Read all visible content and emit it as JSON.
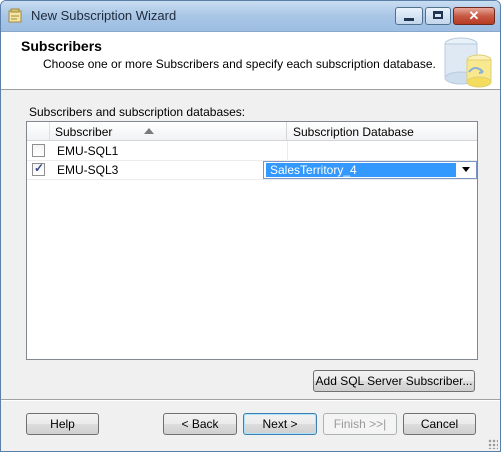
{
  "window": {
    "title": "New Subscription Wizard",
    "close_glyph": "✕"
  },
  "header": {
    "title": "Subscribers",
    "description": "Choose one or more Subscribers and specify each subscription database."
  },
  "section_label": "Subscribers and subscription databases:",
  "grid": {
    "columns": [
      "Subscriber",
      "Subscription Database"
    ],
    "sort_icon": "sort-ascending-icon",
    "rows": [
      {
        "subscriber": "EMU-SQL1",
        "checked": false,
        "database": ""
      },
      {
        "subscriber": "EMU-SQL3",
        "checked": true,
        "database": "SalesTerritory_4"
      }
    ]
  },
  "buttons": {
    "add_subscriber": "Add SQL Server Subscriber...",
    "help": "Help",
    "back": "< Back",
    "next": "Next >",
    "finish": "Finish >>|",
    "cancel": "Cancel"
  },
  "colors": {
    "selection": "#3399ff",
    "titlebar": "#a9c6e6",
    "close_button": "#c75a44"
  }
}
